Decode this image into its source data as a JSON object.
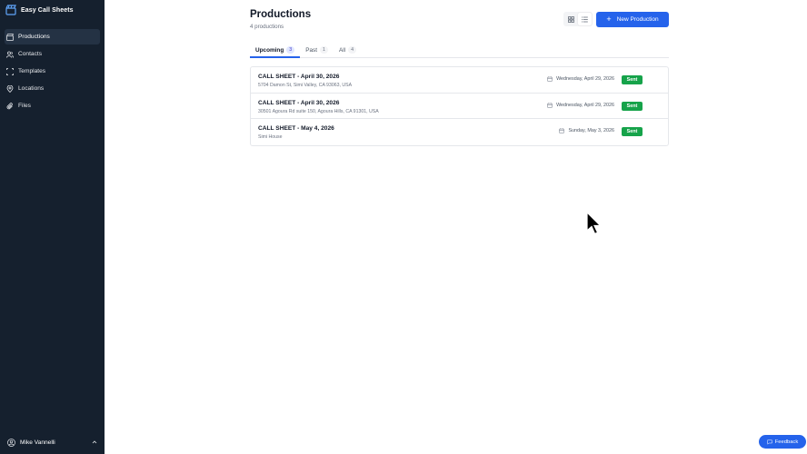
{
  "app": {
    "name": "Easy Call Sheets"
  },
  "sidebar": {
    "items": [
      {
        "label": "Productions",
        "icon": "clapperboard-icon",
        "active": true
      },
      {
        "label": "Contacts",
        "icon": "users-icon",
        "active": false
      },
      {
        "label": "Templates",
        "icon": "layout-icon",
        "active": false
      },
      {
        "label": "Locations",
        "icon": "map-pin-icon",
        "active": false
      },
      {
        "label": "Files",
        "icon": "paperclip-icon",
        "active": false
      }
    ],
    "user": {
      "name": "Mike Vannelli"
    }
  },
  "header": {
    "title": "Productions",
    "subtitle": "4 productions",
    "new_button": "New Production"
  },
  "tabs": [
    {
      "label": "Upcoming",
      "count": "3",
      "active": true
    },
    {
      "label": "Past",
      "count": "1",
      "active": false
    },
    {
      "label": "All",
      "count": "4",
      "active": false
    }
  ],
  "productions": [
    {
      "title": "CALL SHEET - April 30, 2026",
      "location": "5704 Damon St, Simi Valley, CA 93063, USA",
      "date": "Wednesday, April 29, 2026",
      "status": "Sent"
    },
    {
      "title": "CALL SHEET - April 30, 2026",
      "location": "30501 Agoura Rd suite 150, Agoura Hills, CA 91301, USA",
      "date": "Wednesday, April 29, 2026",
      "status": "Sent"
    },
    {
      "title": "CALL SHEET - May 4, 2026",
      "location": "Simi House",
      "date": "Sunday, May 3, 2026",
      "status": "Sent"
    }
  ],
  "feedback": {
    "label": "Feedback"
  },
  "colors": {
    "sidebar": "#15202e",
    "accent": "#2563eb",
    "sent": "#16a34a"
  }
}
